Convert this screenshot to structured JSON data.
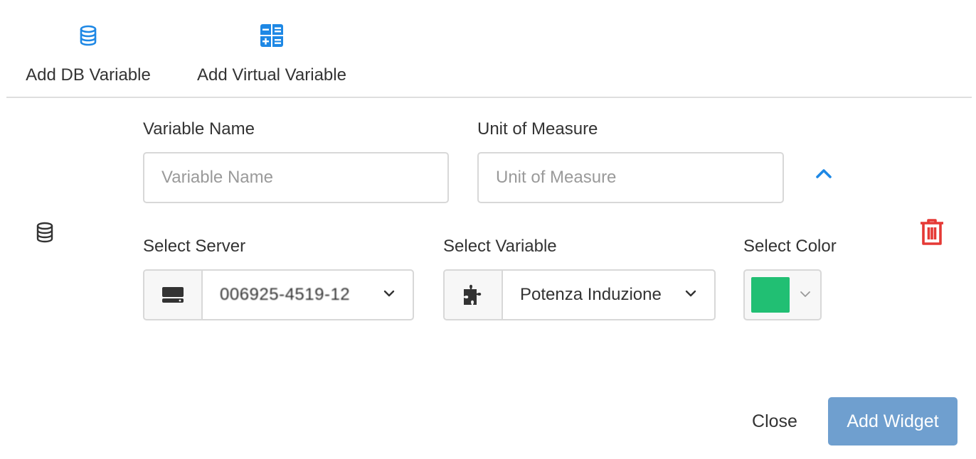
{
  "toolbar": {
    "add_db_variable_label": "Add DB Variable",
    "add_virtual_variable_label": "Add Virtual Variable",
    "add_db_icon": "database-icon",
    "add_virtual_icon": "calculator-icon"
  },
  "form": {
    "variable_name": {
      "label": "Variable Name",
      "placeholder": "Variable Name",
      "value": ""
    },
    "unit_of_measure": {
      "label": "Unit of Measure",
      "placeholder": "Unit of Measure",
      "value": ""
    },
    "collapse_icon": "chevron-up-icon",
    "row_icon": "database-icon",
    "delete_icon": "trash-icon",
    "select_server": {
      "label": "Select Server",
      "value": "006925-4519-12",
      "addon_icon": "server-icon"
    },
    "select_variable": {
      "label": "Select Variable",
      "value": "Potenza Induzione",
      "addon_icon": "puzzle-icon"
    },
    "select_color": {
      "label": "Select Color",
      "value": "#21bf73"
    }
  },
  "footer": {
    "close_label": "Close",
    "add_widget_label": "Add Widget"
  },
  "colors": {
    "accent": "#1e88e5",
    "danger": "#e53935",
    "primary_button": "#6f9fcf",
    "selected_color": "#21bf73"
  }
}
